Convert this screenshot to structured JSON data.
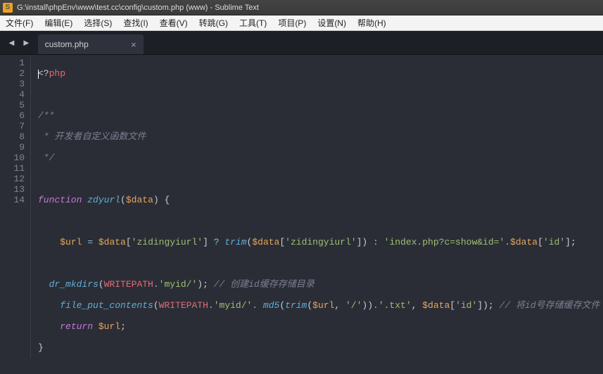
{
  "titlebar": {
    "title": "G:\\install\\phpEnv\\www\\test.cc\\config\\custom.php (www) - Sublime Text"
  },
  "menubar": {
    "items": [
      "文件(F)",
      "编辑(E)",
      "选择(S)",
      "查找(I)",
      "查看(V)",
      "转跳(G)",
      "工具(T)",
      "项目(P)",
      "设置(N)",
      "帮助(H)"
    ]
  },
  "tab": {
    "label": "custom.php",
    "close": "×"
  },
  "tab_nav": {
    "back": "◄",
    "forward": "►"
  },
  "line_count": 14,
  "code": {
    "l1_open": "<?",
    "l1_php": "php",
    "l3_open": "/**",
    "l4": " * 开发者自定义函数文件",
    "l5_close": " */",
    "l7_kw": "function",
    "l7_name": "zdyurl",
    "l7_paren_o": "(",
    "l7_arg": "$data",
    "l7_paren_c": ")",
    "l7_brace": " {",
    "l9_var1": "$url",
    "l9_eq": " = ",
    "l9_v_data1": "$data",
    "l9_b1": "[",
    "l9_s1": "'zidingyiurl'",
    "l9_b1c": "]",
    "l9_q": " ? ",
    "l9_trim": "trim",
    "l9_po": "(",
    "l9_v_data2": "$data",
    "l9_b2": "[",
    "l9_s2": "'zidingyiurl'",
    "l9_b2c": "]",
    "l9_pc": ")",
    "l9_colon": " : ",
    "l9_s3": "'index.php?c=show&id='",
    "l9_dot1": ".",
    "l9_v_data3": "$data",
    "l9_b3": "[",
    "l9_s4": "'id'",
    "l9_b3c": "]",
    "l9_semi": ";",
    "l11_fn": "dr_mkdirs",
    "l11_po": "(",
    "l11_const": "WRITEPATH",
    "l11_dot": ".",
    "l11_str": "'myid/'",
    "l11_pc": ")",
    "l11_semi": "; ",
    "l11_com": "// 创建id缓存存储目录",
    "l12_fn": "file_put_contents",
    "l12_po": "(",
    "l12_const": "WRITEPATH",
    "l12_d1": ".",
    "l12_s1": "'myid/'",
    "l12_d2": ". ",
    "l12_md5": "md5",
    "l12_po2": "(",
    "l12_trim": "trim",
    "l12_po3": "(",
    "l12_url": "$url",
    "l12_c1": ", ",
    "l12_slash": "'/'",
    "l12_pc3": ")",
    "l12_pc2": ")",
    "l12_d3": ".",
    "l12_txt": "'.txt'",
    "l12_c2": ", ",
    "l12_data": "$data",
    "l12_bo": "[",
    "l12_id": "'id'",
    "l12_bc": "]",
    "l12_pc": ")",
    "l12_semi": "; ",
    "l12_com": "// 将id号存储缓存文件",
    "l13_kw": "return",
    "l13_sp": " ",
    "l13_var": "$url",
    "l13_semi": ";",
    "l14_brace": "}"
  }
}
